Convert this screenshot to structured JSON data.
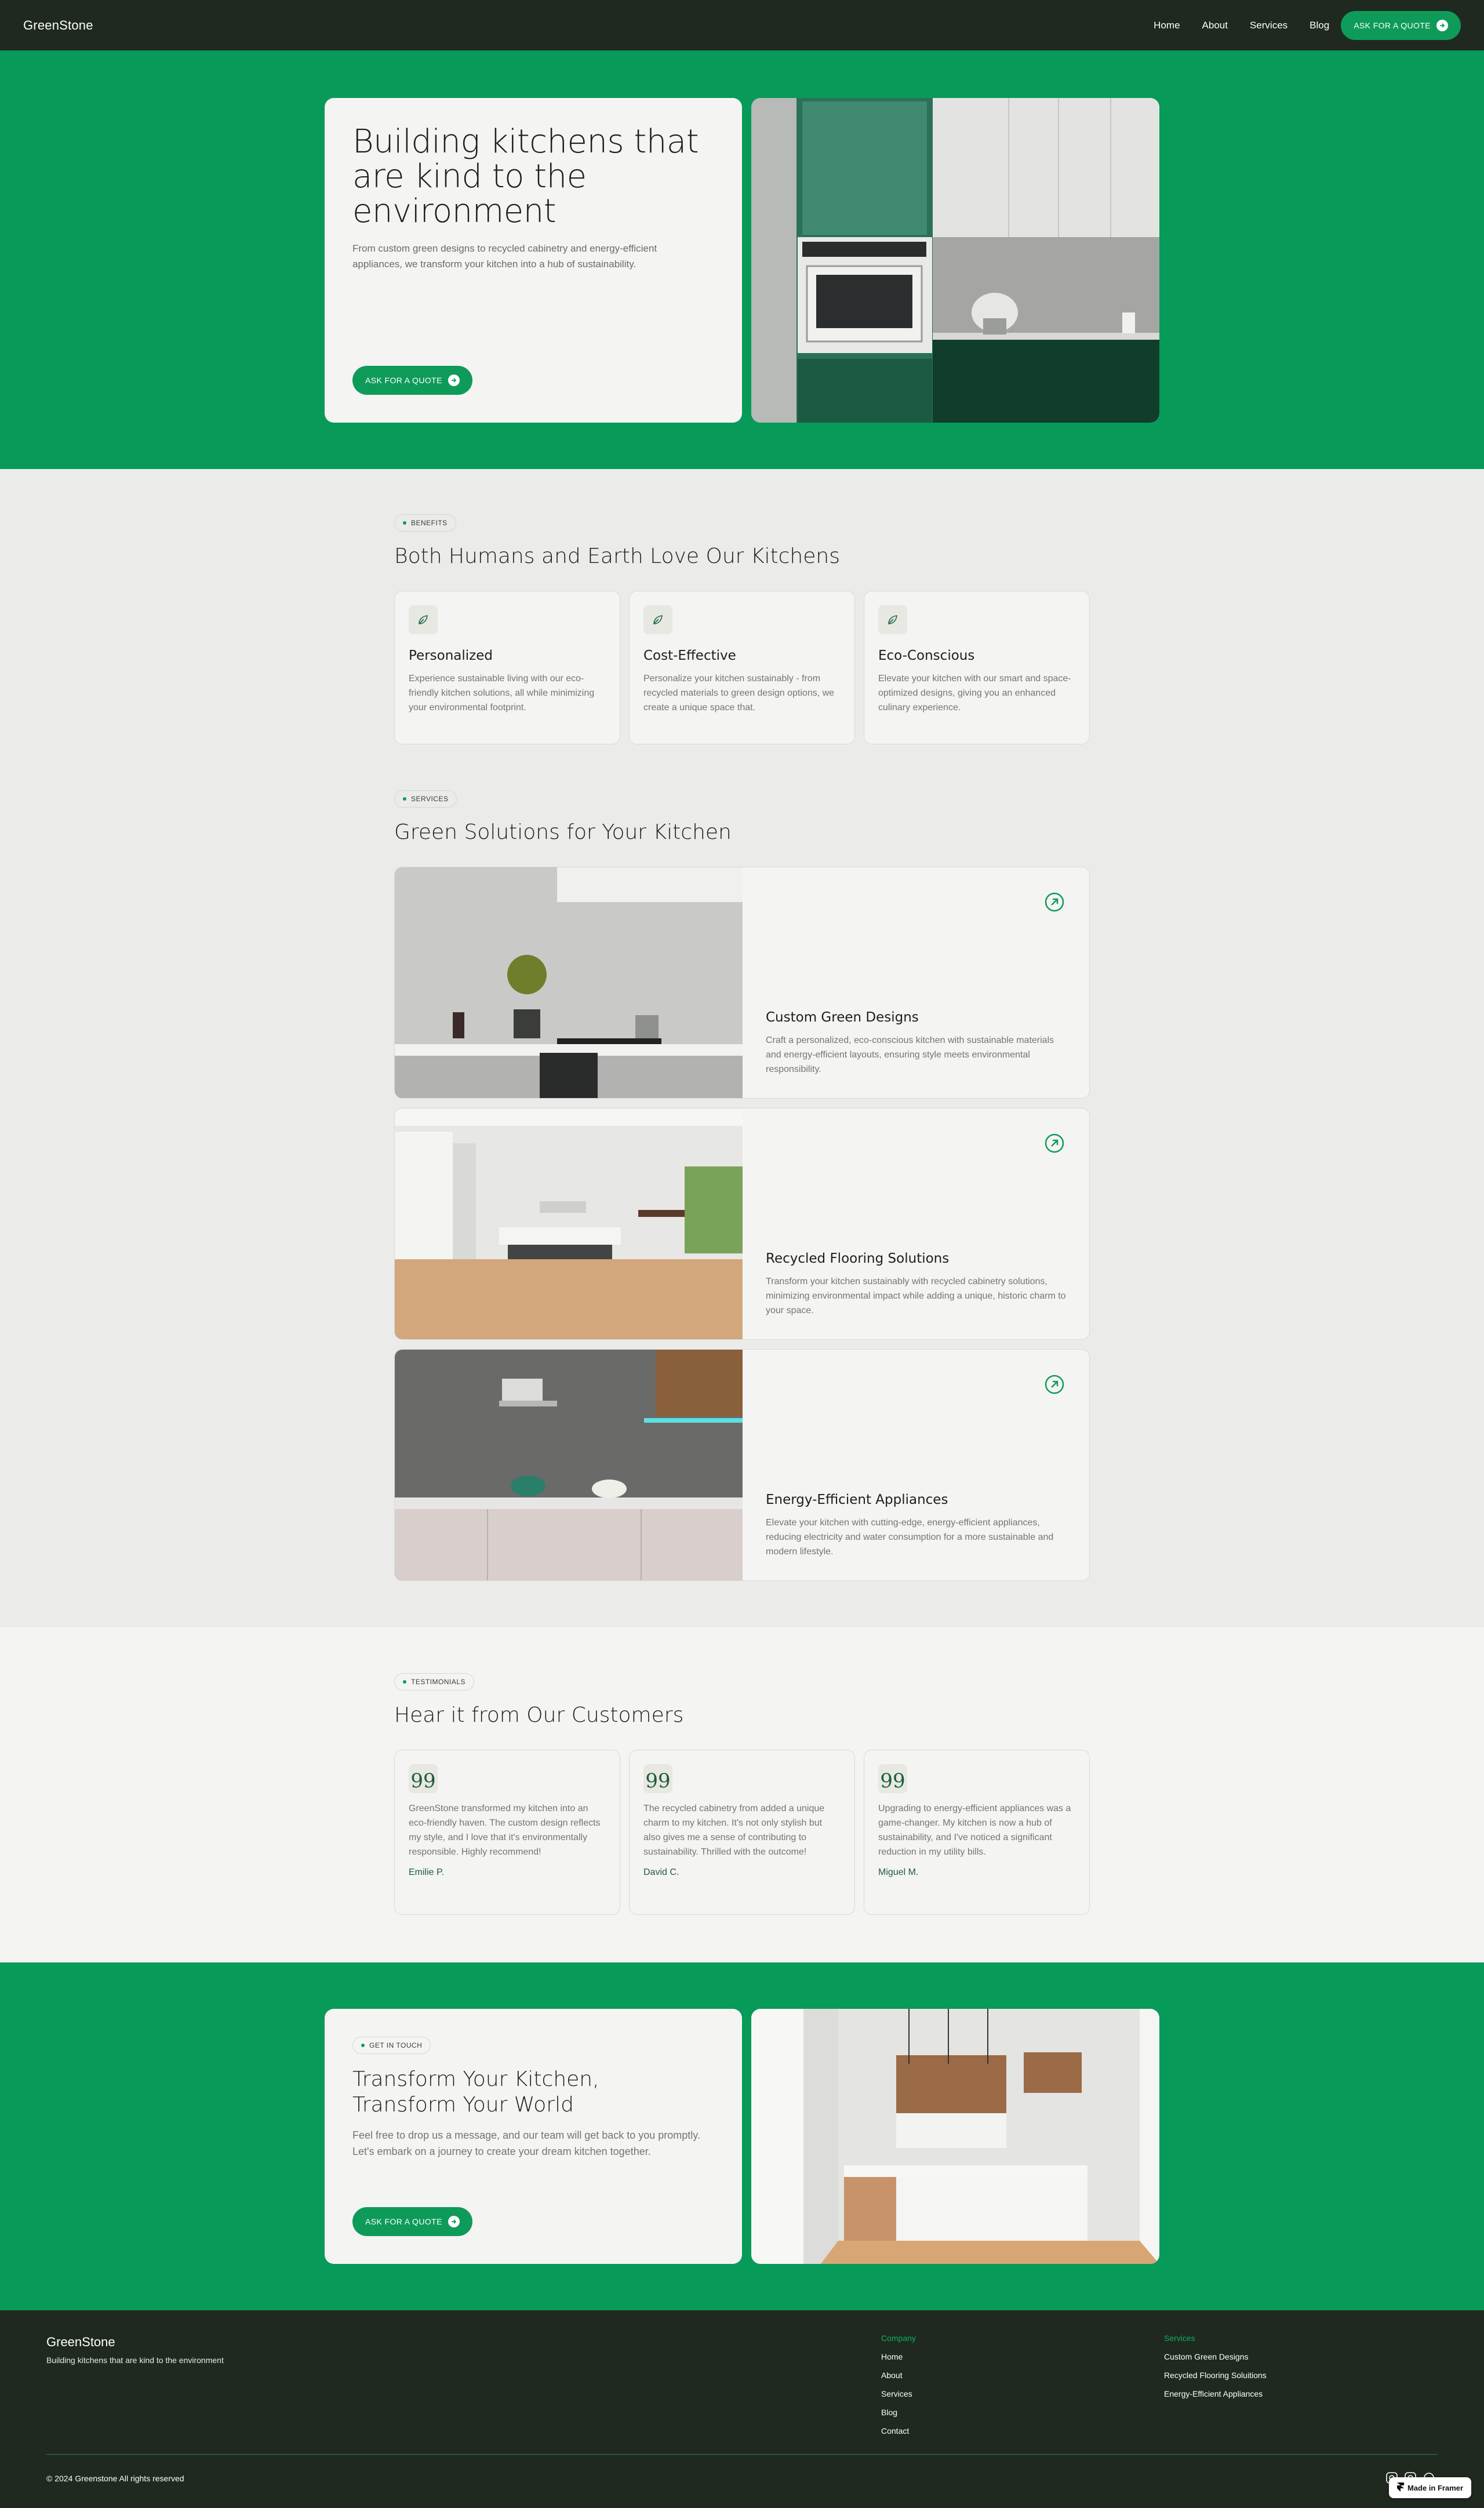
{
  "colors": {
    "brand_green": "#079a58",
    "dark": "#1f2920",
    "light": "#f4f4f3",
    "bg": "#ebebea"
  },
  "nav": {
    "logo": "GreenStone",
    "links": [
      "Home",
      "About",
      "Services",
      "Blog"
    ],
    "cta": "ASK FOR A QUOTE"
  },
  "hero": {
    "title": "Building kitchens that are kind to the environment",
    "text": "From custom green designs to recycled cabinetry and energy-efficient appliances, we transform your kitchen into a hub of sustainability.",
    "cta": "ASK FOR A QUOTE"
  },
  "benefits": {
    "tag": "BENEFITS",
    "title": "Both Humans and Earth Love Our Kitchens",
    "items": [
      {
        "icon": "leaf-icon",
        "title": "Personalized",
        "text": "Experience sustainable living with our eco-friendly kitchen solutions, all while minimizing your environmental footprint."
      },
      {
        "icon": "leaf-icon",
        "title": "Cost-Effective",
        "text": "Personalize your kitchen sustainably - from recycled materials to green design options, we create a unique space that."
      },
      {
        "icon": "leaf-icon",
        "title": "Eco-Conscious",
        "text": "Elevate your kitchen with our smart and space-optimized designs, giving you an enhanced culinary experience."
      }
    ]
  },
  "services": {
    "tag": "SERVICES",
    "title": "Green Solutions for Your Kitchen",
    "items": [
      {
        "title": "Custom Green Designs",
        "text": "Craft a personalized, eco-conscious kitchen with sustainable materials and energy-efficient layouts, ensuring style meets environmental responsibility."
      },
      {
        "title": "Recycled Flooring Solutions",
        "text": "Transform your kitchen sustainably with recycled cabinetry solutions, minimizing environmental impact while adding a unique, historic charm to your space."
      },
      {
        "title": "Energy-Efficient Appliances",
        "text": "Elevate your kitchen with cutting-edge, energy-efficient appliances, reducing electricity and water consumption for a more sustainable and modern lifestyle."
      }
    ]
  },
  "testimonials": {
    "tag": "TESTIMONIALS",
    "title": "Hear it from Our Customers",
    "items": [
      {
        "quote": "GreenStone transformed my kitchen into an eco-friendly haven. The custom design reflects my style, and I love that it's environmentally responsible. Highly recommend!",
        "name": "Emilie P."
      },
      {
        "quote": "The recycled cabinetry from added a unique charm to my kitchen. It's not only stylish but also gives me a sense of contributing to sustainability. Thrilled with the outcome!",
        "name": "David C."
      },
      {
        "quote": "Upgrading to energy-efficient appliances was a game-changer. My kitchen is now a hub of sustainability, and I've noticed a significant reduction in my utility bills.",
        "name": "Miguel M."
      }
    ]
  },
  "cta": {
    "tag": "GET IN TOUCH",
    "title": "Transform Your Kitchen, Transform Your World",
    "text": "Feel free to drop us a message, and our team will get back to you promptly. Let's embark on a journey to create your dream kitchen together.",
    "button": "ASK FOR A QUOTE"
  },
  "footer": {
    "logo": "GreenStone",
    "tagline": "Building kitchens that are kind to the environment",
    "company_heading": "Company",
    "company_links": [
      "Home",
      "About",
      "Services",
      "Blog",
      "Contact"
    ],
    "services_heading": "Services",
    "services_links": [
      "Custom Green Designs",
      "Recycled Flooring Soluitions",
      "Energy-Efficient Appliances"
    ],
    "copyright": "© 2024 Greenstone All rights reserved",
    "badge": "Made in Framer"
  }
}
